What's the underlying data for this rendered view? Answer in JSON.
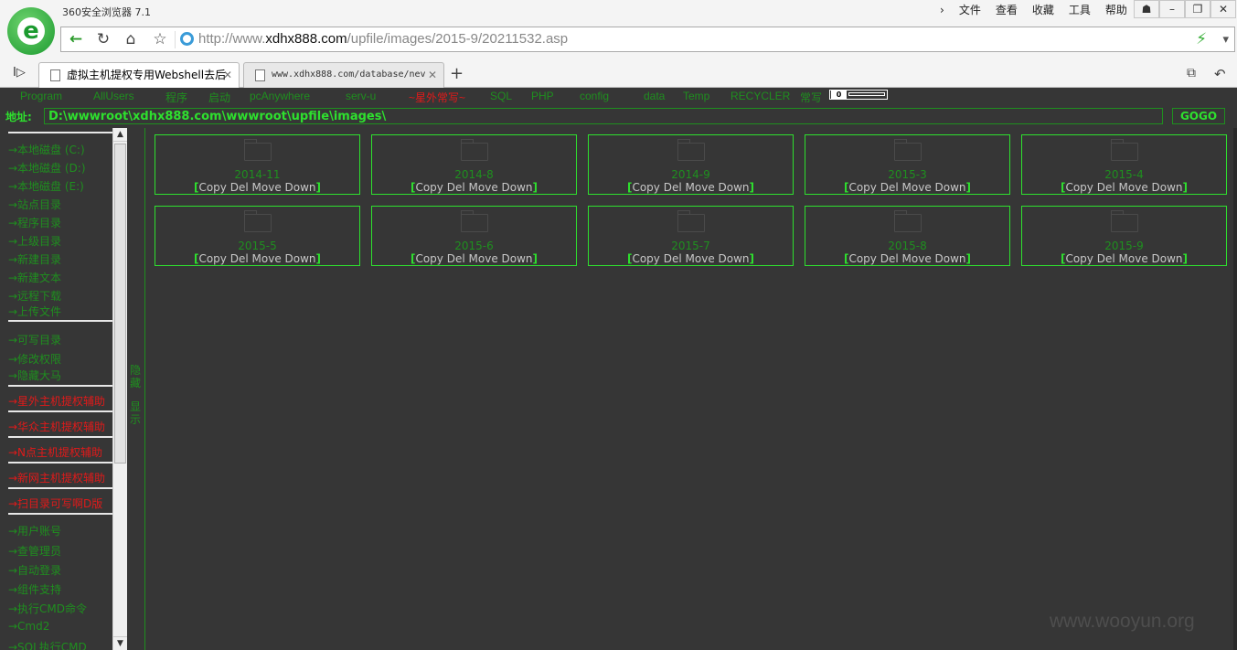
{
  "browser": {
    "title": "360安全浏览器 7.1",
    "menu": [
      "文件",
      "查看",
      "收藏",
      "工具",
      "帮助"
    ],
    "url_prefix": "http://www.",
    "url_domain": "xdhx888.com",
    "url_path": "/upfile/images/2015-9/20211532.asp",
    "tabs": [
      {
        "title": "虚拟主机提权专用Webshell去后"
      },
      {
        "title": "www.xdhx888.com/database/nev"
      }
    ],
    "logo_letter": "e"
  },
  "topnav": [
    {
      "label": "Program",
      "red": false
    },
    {
      "label": "AllUsers",
      "red": false
    },
    {
      "label": "程序",
      "red": false
    },
    {
      "label": "启动",
      "red": false
    },
    {
      "label": "pcAnywhere",
      "red": false
    },
    {
      "label": "serv-u",
      "red": false
    },
    {
      "label": "~星外常写~",
      "red": true
    },
    {
      "label": "SQL",
      "red": false
    },
    {
      "label": "PHP",
      "red": false
    },
    {
      "label": "config",
      "red": false
    },
    {
      "label": "data",
      "red": false
    },
    {
      "label": "Temp",
      "red": false
    },
    {
      "label": "RECYCLER",
      "red": false
    },
    {
      "label": "常写",
      "red": false
    }
  ],
  "counter": "0",
  "address": {
    "label": "地址:",
    "value": "D:\\wwwroot\\xdhx888.com\\wwwroot\\upfile\\images\\",
    "go_label": "GOGO"
  },
  "sidebar": [
    {
      "label": "→本地磁盘 (C:)",
      "red": false
    },
    {
      "label": "→本地磁盘 (D:)",
      "red": false
    },
    {
      "label": "→本地磁盘 (E:)",
      "red": false
    },
    {
      "label": "→站点目录",
      "red": false
    },
    {
      "label": "→程序目录",
      "red": false
    },
    {
      "label": "→上级目录",
      "red": false
    },
    {
      "label": "→新建目录",
      "red": false
    },
    {
      "label": "→新建文本",
      "red": false
    },
    {
      "label": "→远程下载",
      "red": false
    },
    {
      "label": "→上传文件",
      "red": false
    },
    {
      "label": "→可写目录",
      "red": false
    },
    {
      "label": "→修改权限",
      "red": false
    },
    {
      "label": "→隐藏大马",
      "red": false
    },
    {
      "label": "→星外主机提权辅助",
      "red": true
    },
    {
      "label": "→华众主机提权辅助",
      "red": true
    },
    {
      "label": "→N点主机提权辅助",
      "red": true
    },
    {
      "label": "→新网主机提权辅助",
      "red": true
    },
    {
      "label": "→扫目录可写啊D版",
      "red": true
    },
    {
      "label": "→用户账号",
      "red": false
    },
    {
      "label": "→查管理员",
      "red": false
    },
    {
      "label": "→自动登录",
      "red": false
    },
    {
      "label": "→组件支持",
      "red": false
    },
    {
      "label": "→执行CMD命令",
      "red": false
    },
    {
      "label": "→Cmd2",
      "red": false
    },
    {
      "label": "→SQL执行CMD",
      "red": false
    }
  ],
  "toggle": {
    "hide": "隐藏",
    "show": "显示"
  },
  "folder_actions": [
    "Copy",
    "Del",
    "Move",
    "Down"
  ],
  "folders": [
    "2014-11",
    "2014-8",
    "2014-9",
    "2015-3",
    "2015-4",
    "2015-5",
    "2015-6",
    "2015-7",
    "2015-8",
    "2015-9"
  ],
  "watermark": "www.wooyun.org"
}
